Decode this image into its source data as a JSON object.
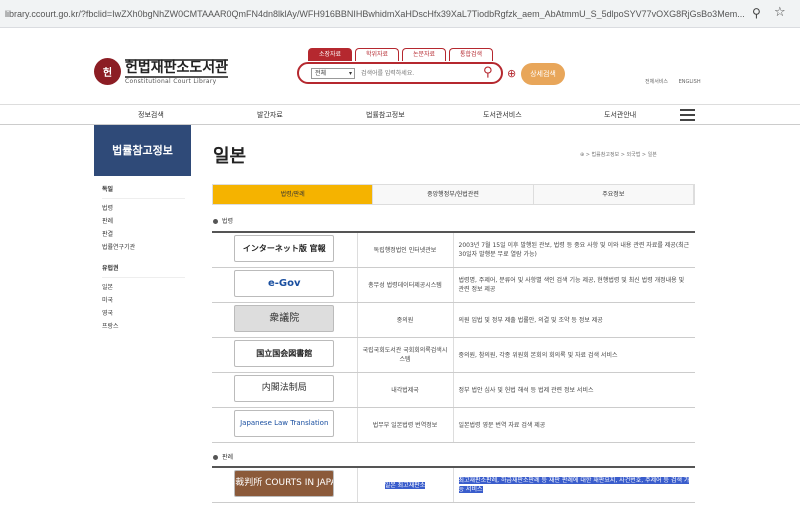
{
  "browser": {
    "url": "library.ccourt.go.kr/?fbclid=IwZXh0bgNhZW0CMTAAAR0QmFN4dn8lklAy/WFH916BBNIHBwhidmXaHDscHfx39XaL7TiodbRgfzk_aem_AbAtmmU_S_5dlpoSYV77vOXG8RjGsBo3Mem..."
  },
  "header": {
    "logo_emblem": "헌",
    "logo_title": "헌법재판소도서관",
    "logo_subtitle": "Constitutional Court Library",
    "search_tabs": [
      "소장자료",
      "학위자료",
      "논문자료",
      "통합검색"
    ],
    "search_select": "전체",
    "search_placeholder": "검색어를 입력하세요.",
    "advanced_search": "상세검색",
    "util_links": [
      "전체서비스",
      "ENGLISH"
    ]
  },
  "gnb": [
    "정보검색",
    "발간자료",
    "법률참고정보",
    "도서관서비스",
    "도서관안내"
  ],
  "sidebar": {
    "title": "법률참고정보",
    "groups": [
      {
        "head": "독일",
        "items": [
          "법령",
          "판례",
          "판결",
          "법률연구기관"
        ]
      },
      {
        "head": "유럽권",
        "items": [
          "일본",
          "미국",
          "영국",
          "프랑스"
        ]
      }
    ]
  },
  "page": {
    "title": "일본",
    "breadcrumb": "⊕ > 법률참고정보 > 외국법 > 일본"
  },
  "tabs": [
    "법령/판례",
    "중앙행정부/헌법관련",
    "주요정보"
  ],
  "section1": "법령",
  "section2": "판례",
  "rows1": [
    {
      "logo": "インターネット版 官報",
      "name": "독립행정법인 인터넷관보",
      "desc": "2003년 7월 15일 이후 발행된 관보, 법령 등 중요 사항 및 이와 내용 관련 자료를 제공(최근 30일자 발행분 무료 열람 가능)"
    },
    {
      "logo": "e-Gov",
      "name": "총무성 법령데이터제공시스템",
      "desc": "법령명, 주제어, 분류어 및 사항별 색인 검색 기능 제공, 현행법령 및 최신 법령 개정내용 및 관련 정보 제공"
    },
    {
      "logo": "衆議院",
      "name": "중의원",
      "desc": "의원 입법 및 정부 제출 법률안, 의결 및 조약 등 정보 제공"
    },
    {
      "logo": "国立国会図書館",
      "name": "국립국회도서관 국회회의록검색시스템",
      "desc": "중의원, 참의원, 각종 위원회 본회의 회의록 및 자료 검색 서비스"
    },
    {
      "logo": "内閣法制局",
      "name": "내각법제국",
      "desc": "정부 법안 심사 및 헌법 해석 등 법제 관련 정보 서비스"
    },
    {
      "logo": "Japanese Law Translation",
      "name": "법무부 일본법령 번역정보",
      "desc": "일본법령 영문 번역 자료 검색 제공"
    }
  ],
  "rows2": [
    {
      "logo": "裁判所 COURTS IN JAPAN",
      "name": "일본 최고재판소",
      "desc": "최고재판소판례, 하급재판소판례 등 재판 판례에 대한 재판요지, 사건번호, 주제어 등 검색 가능 서비스"
    }
  ]
}
